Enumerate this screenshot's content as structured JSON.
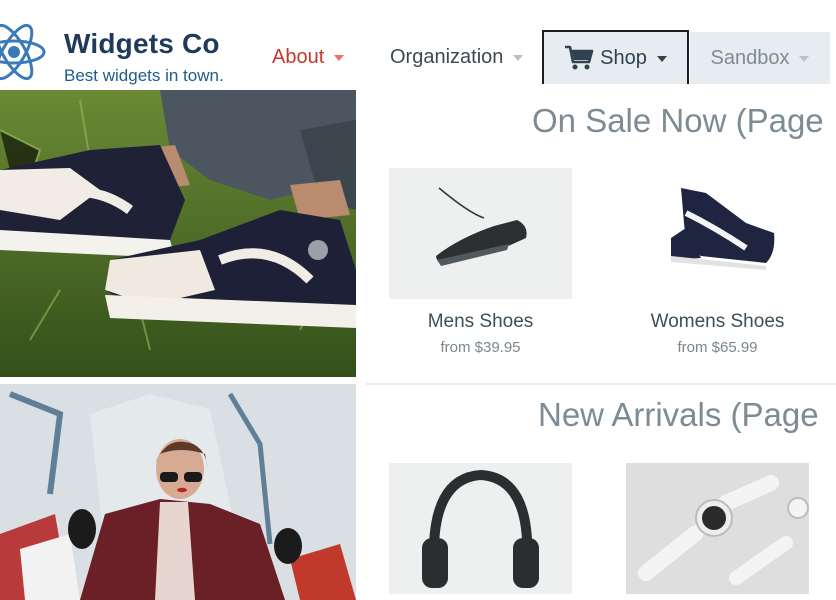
{
  "header": {
    "brand_name": "Widgets Co",
    "tagline": "Best widgets in town."
  },
  "nav": {
    "about": "About",
    "organization": "Organization",
    "shop": "Shop",
    "sandbox": "Sandbox"
  },
  "sections": {
    "on_sale_title": "On Sale Now (Page",
    "new_arrivals_title": "New Arrivals (Page"
  },
  "products": {
    "mens": {
      "name": "Mens Shoes",
      "price": "from $39.95"
    },
    "womens": {
      "name": "Womens Shoes",
      "price": "from $65.99"
    }
  },
  "icons": {
    "logo": "atom-icon",
    "cart": "shopping-cart-icon",
    "caret": "caret-down-icon"
  },
  "colors": {
    "brand": "#1f3a5a",
    "about_accent": "#c8372b",
    "nav_tab_bg": "#e6ecef",
    "section_title": "#7d8b95"
  }
}
